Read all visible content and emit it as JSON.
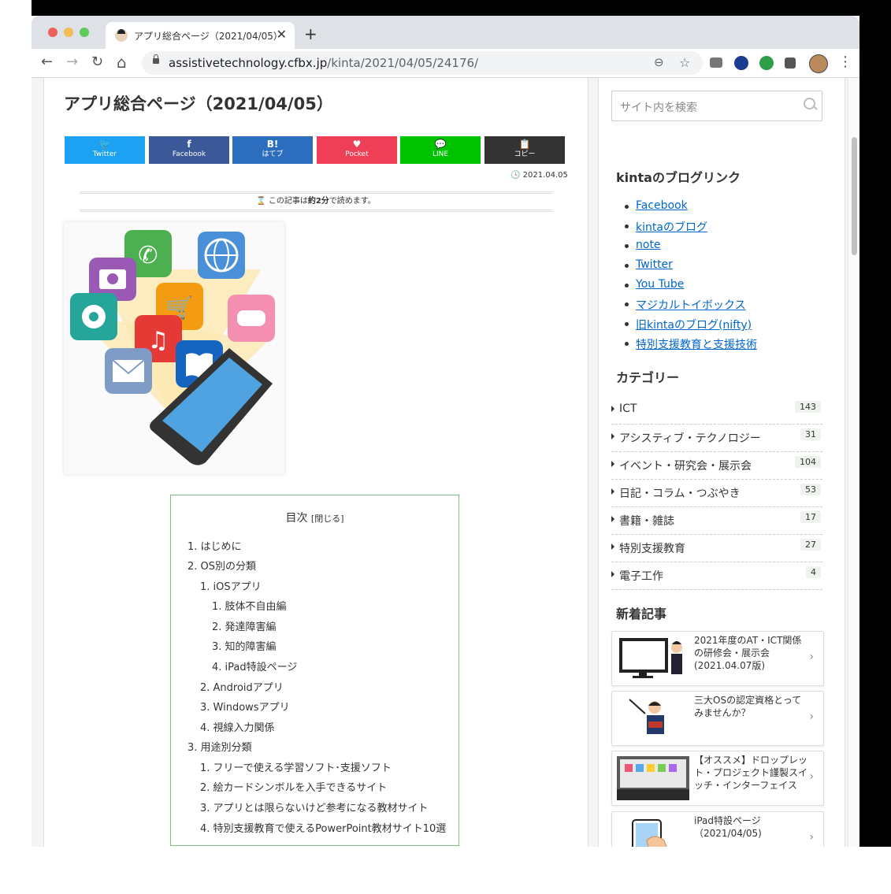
{
  "browser": {
    "tab_title": "アプリ総合ページ（2021/04/05）",
    "tab_close": "✕",
    "new_tab": "+",
    "url_domain": "assistivetechnology.cfbx.jp",
    "url_path": "/kinta/2021/04/05/24176/",
    "nav": {
      "back": "←",
      "forward": "→",
      "reload": "↻",
      "home": "⌂"
    },
    "omni": {
      "zoom": "⊖",
      "star": "☆"
    },
    "menu": "⋮",
    "extensions": [
      {
        "name": "camera",
        "color": "#777777"
      },
      {
        "name": "k-extension",
        "color": "#1a3d8f"
      },
      {
        "name": "green-extension",
        "color": "#2e9e4a"
      },
      {
        "name": "puzzle",
        "color": "#555555"
      }
    ]
  },
  "article": {
    "title": "アプリ総合ページ（2021/04/05）",
    "share_buttons": [
      {
        "icon": "🐦",
        "label": "Twitter",
        "color": "#1da1f2"
      },
      {
        "icon": "f",
        "label": "Facebook",
        "color": "#3b5998"
      },
      {
        "icon": "B!",
        "label": "はてブ",
        "color": "#2c6ebd"
      },
      {
        "icon": "♥",
        "label": "Pocket",
        "color": "#ef3f56"
      },
      {
        "icon": "💬",
        "label": "LINE",
        "color": "#00c300"
      },
      {
        "icon": "📋",
        "label": "コピー",
        "color": "#333333"
      }
    ],
    "date": "🕓 2021.04.05",
    "read_time_prefix": "⌛ この記事は",
    "read_time_value": "約2分",
    "read_time_suffix": "で読めます。",
    "toc": {
      "title": "目次",
      "toggle": "[閉じる]",
      "items": [
        "1. はじめに",
        "2. OS別の分類",
        "1. iOSアプリ",
        "1. 肢体不自由編",
        "2. 発達障害編",
        "3. 知的障害編",
        "4. iPad特設ページ",
        "2. Androidアプリ",
        "3. Windowsアプリ",
        "4. 視線入力関係",
        "3. 用途別分類",
        "1. フリーで使える学習ソフト･支援ソフト",
        "2. 絵カードシンボルを入手できるサイト",
        "3. アプリとは限らないけど参考になる教材サイト",
        "4. 特別支援教育で使えるPowerPoint教材サイト10選"
      ]
    }
  },
  "sidebar": {
    "search_placeholder": "サイト内を検索",
    "links_heading": "kintaのブログリンク",
    "links": [
      "Facebook",
      "kintaのブログ",
      "note",
      "Twitter",
      "You Tube",
      "マジカルトイボックス",
      "旧kintaのブログ(nifty)",
      "特別支援教育と支援技術"
    ],
    "category_heading": "カテゴリー",
    "categories": [
      {
        "name": "ICT",
        "count": "143"
      },
      {
        "name": "アシスティブ・テクノロジー",
        "count": "31"
      },
      {
        "name": "イベント・研究会・展示会",
        "count": "104"
      },
      {
        "name": "日記・コラム・つぶやき",
        "count": "53"
      },
      {
        "name": "書籍・雑誌",
        "count": "17"
      },
      {
        "name": "特別支援教育",
        "count": "27"
      },
      {
        "name": "電子工作",
        "count": "4"
      }
    ],
    "recent_heading": "新着記事",
    "recent": [
      {
        "title": "2021年度のAT・ICT関係の研修会・展示会(2021.04.07版)"
      },
      {
        "title": "三大OSの認定資格とってみませんか？"
      },
      {
        "title": "【オススメ】ドロップレット・プロジェクト謹製スイッチ・インターフェイス"
      },
      {
        "title": "iPad特設ページ（2021/04/05)"
      }
    ],
    "arrow": "›"
  }
}
